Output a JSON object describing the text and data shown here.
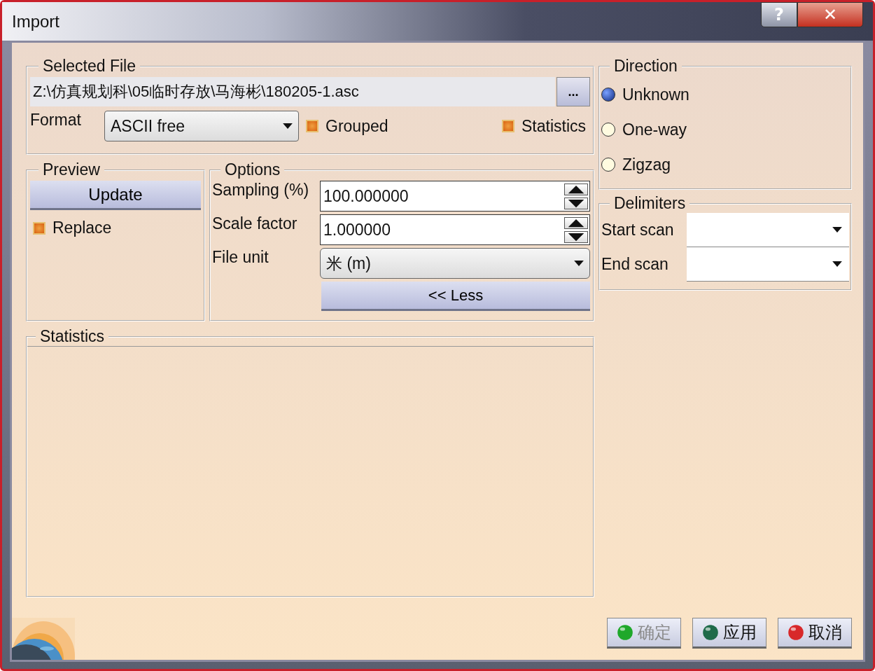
{
  "window": {
    "title": "Import",
    "help": "?",
    "close": "✕"
  },
  "selected_file": {
    "label": "Selected File",
    "path": "Z:\\仿真规划科\\05临时存放\\马海彬\\180205-1.asc",
    "browse": "...",
    "format_label": "Format",
    "format": "ASCII free",
    "checkboxes": [
      {
        "label": "Grouped",
        "checked": true
      },
      {
        "label": "Statistics",
        "checked": true
      }
    ]
  },
  "preview": {
    "label": "Preview",
    "update": "Update",
    "replace": {
      "label": "Replace",
      "checked": true
    }
  },
  "options": {
    "label": "Options",
    "rows": [
      {
        "kind": "spin",
        "label": "Sampling (%)",
        "value": "100.000000"
      },
      {
        "kind": "spin",
        "label": "Scale factor",
        "value": "1.000000"
      },
      {
        "kind": "dropdown",
        "label": "File unit",
        "value": "米 (m)"
      }
    ],
    "less": "<< Less"
  },
  "direction": {
    "label": "Direction",
    "options": [
      {
        "label": "Unknown",
        "selected": true
      },
      {
        "label": "One-way",
        "selected": false
      },
      {
        "label": "Zigzag",
        "selected": false
      }
    ]
  },
  "delimiters": {
    "label": "Delimiters",
    "rows": [
      {
        "label": "Start scan"
      },
      {
        "label": "End scan"
      }
    ]
  },
  "statistics": {
    "label": "Statistics"
  },
  "buttons": [
    {
      "label": "确定",
      "color": "#1fa82a",
      "disabled": true
    },
    {
      "label": "应用",
      "color": "#1f6b4a",
      "disabled": false
    },
    {
      "label": "取消",
      "color": "#d8282a",
      "disabled": false
    }
  ]
}
